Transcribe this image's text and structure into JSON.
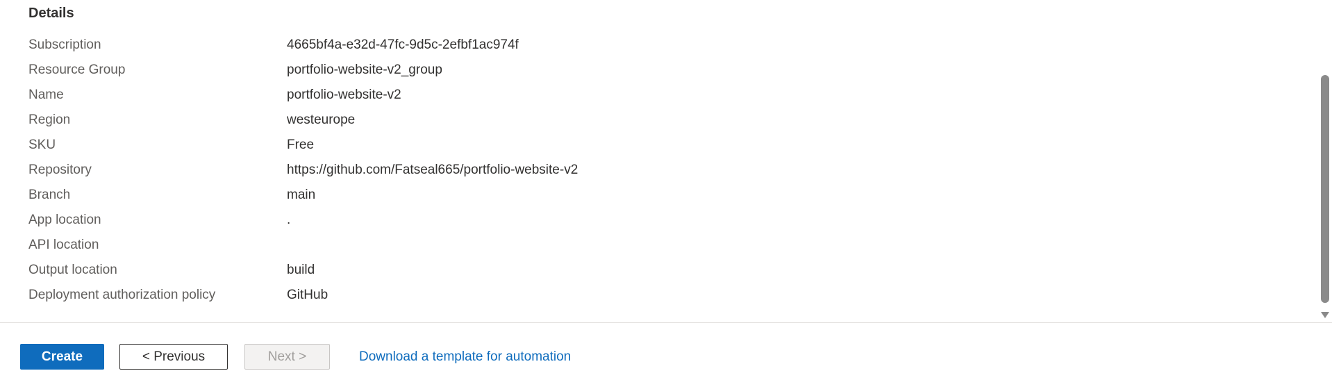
{
  "section": {
    "title": "Details"
  },
  "details": [
    {
      "label": "Subscription",
      "value": "4665bf4a-e32d-47fc-9d5c-2efbf1ac974f"
    },
    {
      "label": "Resource Group",
      "value": "portfolio-website-v2_group"
    },
    {
      "label": "Name",
      "value": "portfolio-website-v2"
    },
    {
      "label": "Region",
      "value": "westeurope"
    },
    {
      "label": "SKU",
      "value": "Free"
    },
    {
      "label": "Repository",
      "value": "https://github.com/Fatseal665/portfolio-website-v2"
    },
    {
      "label": "Branch",
      "value": "main"
    },
    {
      "label": "App location",
      "value": "."
    },
    {
      "label": "API location",
      "value": ""
    },
    {
      "label": "Output location",
      "value": "build"
    },
    {
      "label": "Deployment authorization policy",
      "value": "GitHub"
    }
  ],
  "footer": {
    "create_label": "Create",
    "previous_label": "< Previous",
    "next_label": "Next >",
    "download_link": "Download a template for automation"
  },
  "colors": {
    "accent": "#0f6cbd",
    "label_text": "#605e5c",
    "value_text": "#323130"
  }
}
